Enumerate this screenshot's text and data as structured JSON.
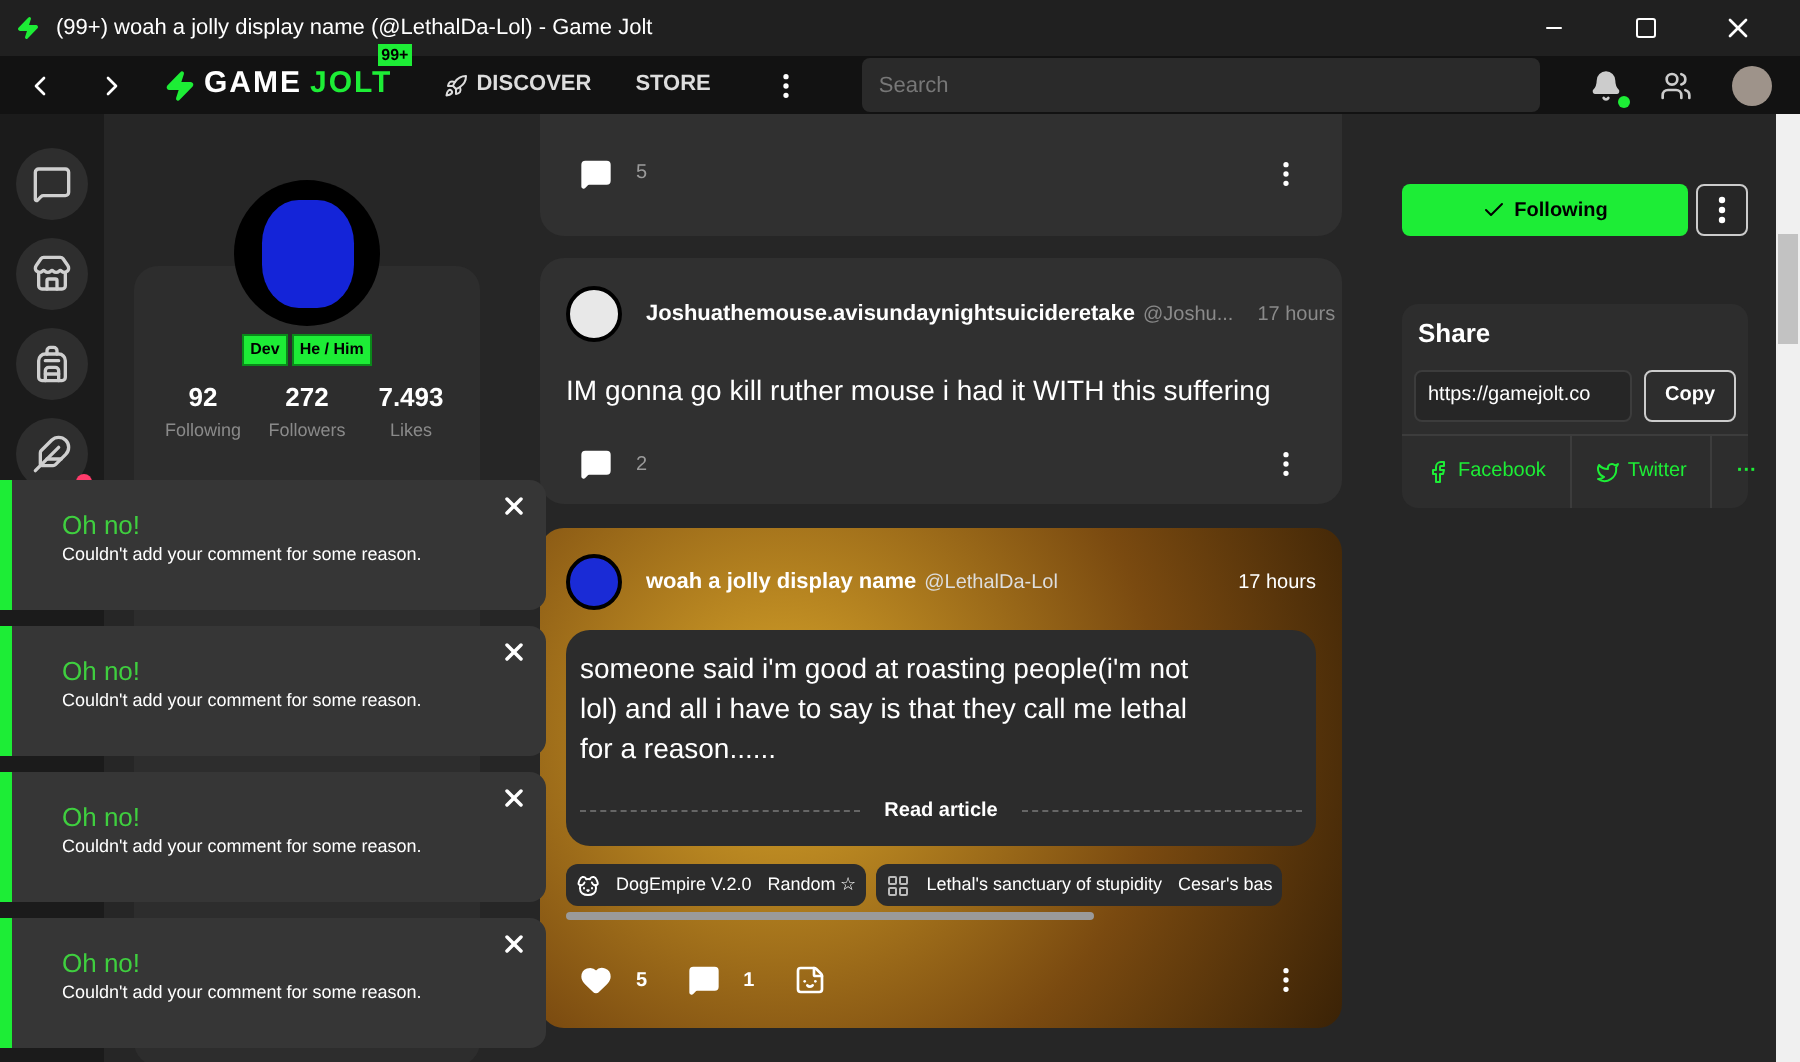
{
  "window": {
    "title": "(99+) woah a jolly display name (@LethalDa-Lol) - Game Jolt"
  },
  "nav": {
    "logo_left": "GAME",
    "logo_right": "JOLT",
    "badge": "99+",
    "links": [
      {
        "label": "DISCOVER",
        "kind": "discover"
      },
      {
        "label": "STORE",
        "kind": "plain"
      }
    ],
    "search": {
      "placeholder": "Search"
    },
    "notifications_unread": true
  },
  "sidebar": {
    "items": [
      {
        "kind": "chat",
        "unread": false
      },
      {
        "kind": "store",
        "unread": false
      },
      {
        "kind": "backpack",
        "unread": false
      },
      {
        "kind": "quest",
        "unread": true
      }
    ]
  },
  "profile": {
    "tags": [
      "Dev",
      "He / Him"
    ],
    "stats": [
      {
        "value": "92",
        "label": "Following"
      },
      {
        "value": "272",
        "label": "Followers"
      },
      {
        "value": "7.493",
        "label": "Likes"
      }
    ]
  },
  "posts": [
    {
      "kind": "tail",
      "comments": "5"
    },
    {
      "kind": "text",
      "author": "Joshuathemouse.avisundaynightsuicideretake",
      "handle": "@Joshu...",
      "time": "17 hours",
      "body": "IM gonna go kill ruther mouse i had it WITH this suffering",
      "comments": "2"
    },
    {
      "kind": "article",
      "author": "woah a jolly display name",
      "handle": "@LethalDa-Lol",
      "time": "17 hours",
      "body": "someone said i'm good at roasting people(i'm not lol) and all i have to say is that they call me lethal for a reason......",
      "link": "Read article",
      "communities": [
        {
          "name": "DogEmpire V.2.0",
          "channel": "Random ☆"
        },
        {
          "name": "Lethal's sanctuary of stupidity",
          "channel": "Cesar's bas"
        }
      ],
      "likes": "5",
      "comments": "1"
    }
  ],
  "right": {
    "follow": {
      "label": "Following",
      "selected": true
    },
    "share": {
      "title": "Share",
      "url": "https://gamejolt.co",
      "copy": "Copy",
      "networks": [
        {
          "label": "Facebook",
          "kind": "facebook"
        },
        {
          "label": "Twitter",
          "kind": "twitter"
        }
      ],
      "more": "···"
    }
  },
  "toasts": [
    {
      "title": "Oh no!",
      "message": "Couldn't add your comment for some reason."
    },
    {
      "title": "Oh no!",
      "message": "Couldn't add your comment for some reason."
    },
    {
      "title": "Oh no!",
      "message": "Couldn't add your comment for some reason."
    },
    {
      "title": "Oh no!",
      "message": "Couldn't add your comment for some reason."
    }
  ]
}
